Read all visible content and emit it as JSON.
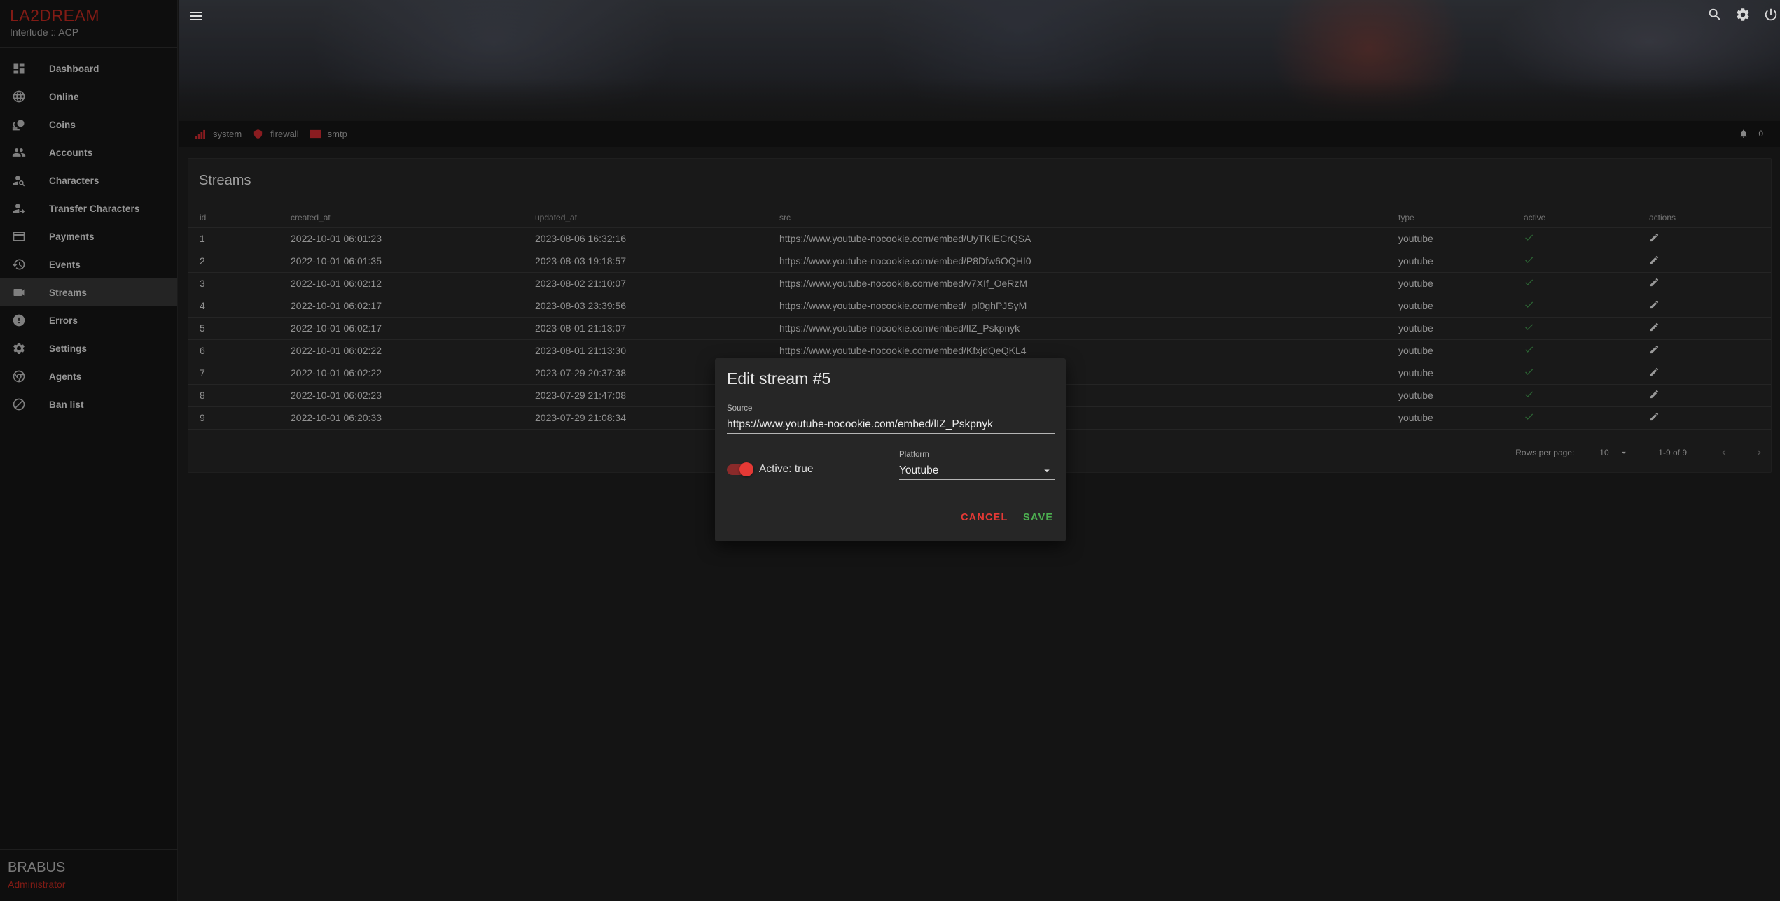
{
  "brand": {
    "title": "LA2DREAM",
    "subtitle": "Interlude :: ACP"
  },
  "sidebar": {
    "items": [
      {
        "label": "Dashboard",
        "icon": "dashboard-icon"
      },
      {
        "label": "Online",
        "icon": "globe-icon"
      },
      {
        "label": "Coins",
        "icon": "coins-icon"
      },
      {
        "label": "Accounts",
        "icon": "people-icon"
      },
      {
        "label": "Characters",
        "icon": "person-search-icon"
      },
      {
        "label": "Transfer Characters",
        "icon": "person-transfer-icon"
      },
      {
        "label": "Payments",
        "icon": "credit-card-icon"
      },
      {
        "label": "Events",
        "icon": "history-icon"
      },
      {
        "label": "Streams",
        "icon": "video-camera-icon",
        "active": true
      },
      {
        "label": "Errors",
        "icon": "error-icon"
      },
      {
        "label": "Settings",
        "icon": "gear-icon"
      },
      {
        "label": "Agents",
        "icon": "chrome-icon"
      },
      {
        "label": "Ban list",
        "icon": "block-icon"
      }
    ]
  },
  "user": {
    "name": "BRABUS",
    "role": "Administrator"
  },
  "statusbar": {
    "items": [
      {
        "label": "system",
        "icon": "signal-icon"
      },
      {
        "label": "firewall",
        "icon": "shield-icon"
      },
      {
        "label": "smtp",
        "icon": "mail-icon"
      }
    ],
    "notifications": "0"
  },
  "streams": {
    "title": "Streams",
    "columns": [
      "id",
      "created_at",
      "updated_at",
      "src",
      "type",
      "active",
      "actions"
    ],
    "rows": [
      {
        "id": "1",
        "created_at": "2022-10-01 06:01:23",
        "updated_at": "2023-08-06 16:32:16",
        "src": "https://www.youtube-nocookie.com/embed/UyTKIECrQSA",
        "type": "youtube",
        "active": true
      },
      {
        "id": "2",
        "created_at": "2022-10-01 06:01:35",
        "updated_at": "2023-08-03 19:18:57",
        "src": "https://www.youtube-nocookie.com/embed/P8Dfw6OQHI0",
        "type": "youtube",
        "active": true
      },
      {
        "id": "3",
        "created_at": "2022-10-01 06:02:12",
        "updated_at": "2023-08-02 21:10:07",
        "src": "https://www.youtube-nocookie.com/embed/v7XIf_OeRzM",
        "type": "youtube",
        "active": true
      },
      {
        "id": "4",
        "created_at": "2022-10-01 06:02:17",
        "updated_at": "2023-08-03 23:39:56",
        "src": "https://www.youtube-nocookie.com/embed/_pl0ghPJSyM",
        "type": "youtube",
        "active": true
      },
      {
        "id": "5",
        "created_at": "2022-10-01 06:02:17",
        "updated_at": "2023-08-01 21:13:07",
        "src": "https://www.youtube-nocookie.com/embed/lIZ_Pskpnyk",
        "type": "youtube",
        "active": true
      },
      {
        "id": "6",
        "created_at": "2022-10-01 06:02:22",
        "updated_at": "2023-08-01 21:13:30",
        "src": "https://www.youtube-nocookie.com/embed/KfxjdQeQKL4",
        "type": "youtube",
        "active": true
      },
      {
        "id": "7",
        "created_at": "2022-10-01 06:02:22",
        "updated_at": "2023-07-29 20:37:38",
        "src": "",
        "type": "youtube",
        "active": true
      },
      {
        "id": "8",
        "created_at": "2022-10-01 06:02:23",
        "updated_at": "2023-07-29 21:47:08",
        "src": "",
        "type": "youtube",
        "active": true
      },
      {
        "id": "9",
        "created_at": "2022-10-01 06:20:33",
        "updated_at": "2023-07-29 21:08:34",
        "src": "",
        "type": "youtube",
        "active": true
      }
    ],
    "pagination": {
      "rows_per_page_label": "Rows per page:",
      "rows_per_page": "10",
      "range": "1-9 of 9"
    }
  },
  "dialog": {
    "title": "Edit stream #5",
    "source_label": "Source",
    "source_value": "https://www.youtube-nocookie.com/embed/lIZ_Pskpnyk",
    "active_label": "Active: true",
    "active": true,
    "platform_label": "Platform",
    "platform_value": "Youtube",
    "cancel_label": "CANCEL",
    "save_label": "SAVE"
  },
  "colors": {
    "accent_red": "#b3261e",
    "save_green": "#4caf50",
    "check_green": "#3e8e48"
  }
}
